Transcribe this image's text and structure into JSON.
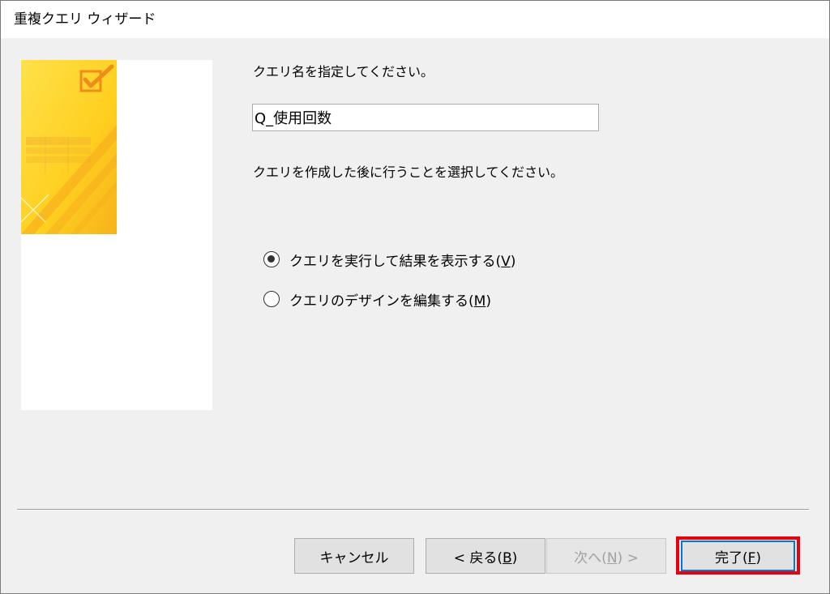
{
  "window": {
    "title": "重複クエリ ウィザード"
  },
  "prompts": {
    "query_name": "クエリ名を指定してください。",
    "after_create": "クエリを作成した後に行うことを選択してください。"
  },
  "query_name_input": {
    "value": "Q_使用回数"
  },
  "options": [
    {
      "label": "クエリを実行して結果を表示する(",
      "mnemonic": "V",
      "suffix": ")",
      "checked": true
    },
    {
      "label": "クエリのデザインを編集する(",
      "mnemonic": "M",
      "suffix": ")",
      "checked": false
    }
  ],
  "buttons": {
    "cancel": "キャンセル",
    "back_prefix": "< 戻る(",
    "back_mnemonic": "B",
    "back_suffix": ")",
    "next_prefix": "次へ(",
    "next_mnemonic": "N",
    "next_suffix": ") >",
    "finish_prefix": "完了(",
    "finish_mnemonic": "F",
    "finish_suffix": ")"
  },
  "colors": {
    "highlight": "#e8000c",
    "art_yellow": "#ffd21f",
    "art_orange": "#f5a623"
  },
  "icons": {
    "wizard_art": "yellow-checkbox-table-art"
  }
}
